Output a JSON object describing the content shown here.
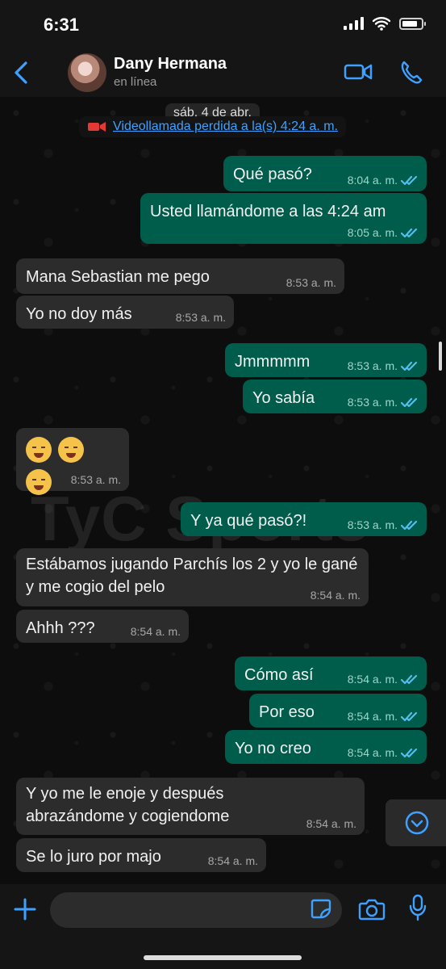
{
  "status": {
    "time": "6:31"
  },
  "header": {
    "contact_name": "Dany Hermana",
    "contact_status": "en línea",
    "icons": [
      "back-arrow",
      "video-call",
      "phone-call"
    ]
  },
  "chat": {
    "date": "sáb, 4 de abr.",
    "missed_call": "Videollamada perdida a la(s) 4:24 a. m.",
    "watermark": "TyC Sports",
    "messages": [
      {
        "direction": "out",
        "text": "Qué pasó?",
        "time": "8:04 a. m."
      },
      {
        "direction": "out",
        "text": "Usted llamándome a las 4:24 am",
        "time": "8:05 a. m."
      },
      {
        "direction": "in",
        "text": "Mana Sebastian me pego",
        "time": "8:53 a. m."
      },
      {
        "direction": "in",
        "text": "Yo no doy más",
        "time": "8:53 a. m."
      },
      {
        "direction": "out",
        "text": "Jmmmmm",
        "time": "8:53 a. m."
      },
      {
        "direction": "out",
        "text": "Yo sabía",
        "time": "8:53 a. m."
      },
      {
        "direction": "in",
        "text": "😭😭😭",
        "time": "8:53 a. m."
      },
      {
        "direction": "out",
        "text": "Y ya qué pasó?!",
        "time": "8:53 a. m."
      },
      {
        "direction": "in",
        "text": "Estábamos jugando Parchís los 2 y yo le gané y me cogio del pelo",
        "time": "8:54 a. m."
      },
      {
        "direction": "in",
        "text": "Ahhh ???",
        "time": "8:54 a. m."
      },
      {
        "direction": "out",
        "text": "Cómo así",
        "time": "8:54 a. m."
      },
      {
        "direction": "out",
        "text": "Por eso",
        "time": "8:54 a. m."
      },
      {
        "direction": "out",
        "text": "Yo no creo",
        "time": "8:54 a. m."
      },
      {
        "direction": "in",
        "text": "Y yo me le enoje y después abrazándome y cogiendome",
        "time": "8:54 a. m."
      },
      {
        "direction": "in",
        "text": "Se lo juro por majo",
        "time": "8:54 a. m."
      }
    ]
  },
  "composer": {
    "icons": [
      "plus",
      "sticker",
      "camera",
      "microphone"
    ]
  },
  "colors": {
    "incoming": "#2c2c2d",
    "outgoing": "#005c4b",
    "accent": "#3fa1ff"
  }
}
